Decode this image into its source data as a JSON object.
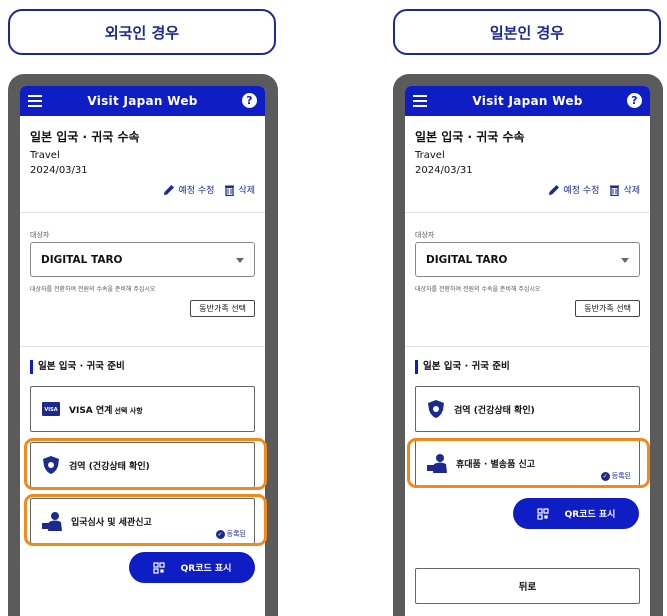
{
  "left": {
    "case_label": "외국인 경우",
    "app_title": "Visit Japan Web",
    "procedure_title": "일본 입국 · 귀국 수속",
    "trip_name": "Travel",
    "trip_date": "2024/03/31",
    "edit_plan": "예정 수정",
    "delete": "삭제",
    "target_label": "대상자",
    "target_value": "DIGITAL TARO",
    "target_hint": "대상자를 전환하여 전원의 수속을 준비해 주십시오",
    "companion_button": "동반가족 선택",
    "section_title": "일본 입국 · 귀국 준비",
    "visa_card": "VISA 연계",
    "visa_optional": "선택 사항",
    "quarantine_card": "검역 (건강상태 확인)",
    "immigration_card": "입국심사 및 세관신고",
    "registered_badge": "등록된",
    "qr_button": "QR코드 표시"
  },
  "right": {
    "case_label": "일본인 경우",
    "app_title": "Visit Japan Web",
    "procedure_title": "일본 입국 · 귀국 수속",
    "trip_name": "Travel",
    "trip_date": "2024/03/31",
    "edit_plan": "예정 수정",
    "delete": "삭제",
    "target_label": "대상자",
    "target_value": "DIGITAL TARO",
    "target_hint": "대상자를 전환하여 전원의 수속을 준비해 주십시오",
    "companion_button": "동반가족 선택",
    "section_title": "일본 입국 · 귀국 준비",
    "quarantine_card": "검역 (건강상태 확인)",
    "customs_card": "휴대품 · 별송품 신고",
    "registered_badge": "등록된",
    "qr_button": "QR코드 표시",
    "back_button": "뒤로"
  },
  "colors": {
    "brand": "#0e1ec4",
    "accent": "#1b2a8c",
    "highlight": "#f08a1c",
    "phone_frame": "#5b5b5b"
  },
  "icons": [
    "menu-icon",
    "help-icon",
    "pencil-icon",
    "trash-icon",
    "visa-card-icon",
    "shield-virus-icon",
    "customs-officer-icon",
    "qr-code-icon",
    "check-circle-icon"
  ]
}
